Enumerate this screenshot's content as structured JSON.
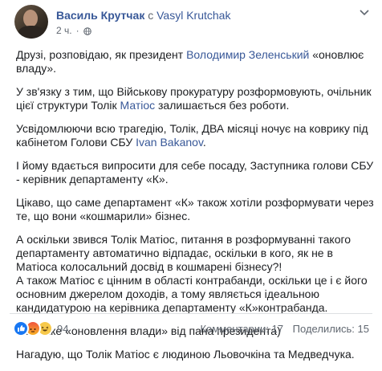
{
  "post": {
    "author": "Василь Крутчак",
    "with_word": "с",
    "tagged": "Vasyl Krutchak",
    "time": "2 ч.",
    "paragraphs": [
      {
        "segments": [
          {
            "text": "Друзі, розповідаю, як президент ",
            "link": false
          },
          {
            "text": "Володимир Зеленський",
            "link": true
          },
          {
            "text": " «оновлює владу».",
            "link": false
          }
        ]
      },
      {
        "segments": [
          {
            "text": "У зв'язку з тим, що Військову прокуратуру розформовують, очільник цієї структури Толік ",
            "link": false
          },
          {
            "text": "Матіос",
            "link": true
          },
          {
            "text": " залишається без роботи.",
            "link": false
          }
        ]
      },
      {
        "segments": [
          {
            "text": "Усвідомлюючи всю трагедію, Толік, ДВА місяці ночує на коврику під кабінетом Голови СБУ ",
            "link": false
          },
          {
            "text": "Ivan Bakanov",
            "link": true
          },
          {
            "text": ".",
            "link": false
          }
        ]
      },
      {
        "segments": [
          {
            "text": "І йому вдається випросити для себе посаду, Заступника голови СБУ - керівник департаменту «К».",
            "link": false
          }
        ]
      },
      {
        "segments": [
          {
            "text": "Цікаво, що саме департамент «К» також хотіли розформувати через те, що вони «кошмарили» бізнес.",
            "link": false
          }
        ]
      },
      {
        "segments": [
          {
            "text": "А оскільки звився Толік Матіос, питання в розформуванні такого департаменту автоматично відпадає, оскільки в кого, як не в Матіоса колосальний досвід в кошмарені бізнесу?!\nА також Матіос є цінним в області контрабанди, оскільки це і є його основним джерелом доходів, а тому являється ідеальною кандидатурою на керівника департаменту «К»контрабанда.",
            "link": false
          }
        ]
      },
      {
        "segments": [
          {
            "text": "Ось таке «оновлення влади» від пана президента)",
            "link": false
          }
        ]
      },
      {
        "segments": [
          {
            "text": "Нагадую, що Толік Матіос є людиною Льовочкіна та Медведчука.",
            "link": false
          }
        ]
      }
    ]
  },
  "footer": {
    "reaction_icons": [
      "like-icon",
      "angry-icon",
      "haha-icon"
    ],
    "reaction_count": "94",
    "comments": "Комментарии: 17",
    "shares": "Поделились: 15"
  },
  "colors": {
    "link": "#385898",
    "muted": "#606770",
    "text": "#1c1e21",
    "like": "#1877f2"
  }
}
